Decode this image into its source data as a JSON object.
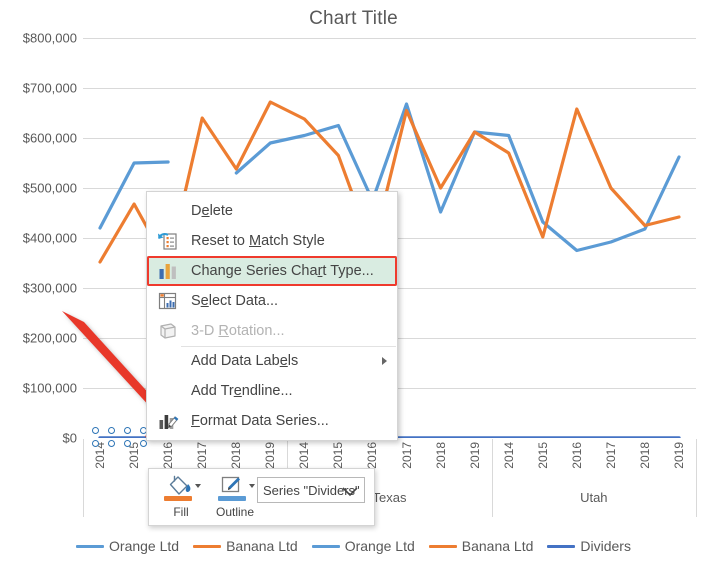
{
  "chart": {
    "title": "Chart Title",
    "y_ticks": [
      "$800,000",
      "$700,000",
      "$600,000",
      "$500,000",
      "$400,000",
      "$300,000",
      "$200,000",
      "$100,000",
      "$0"
    ],
    "years": [
      "2014",
      "2015",
      "2016",
      "2017",
      "2018",
      "2019"
    ],
    "groups": [
      "Texas",
      "Utah"
    ]
  },
  "chart_data": {
    "type": "line",
    "title": "Chart Title",
    "xlabel": "",
    "ylabel": "",
    "ylim": [
      0,
      800000
    ],
    "ytick_step": 100000,
    "grid": true,
    "legend_position": "bottom",
    "axis_note": "Two-level category axis: year (2014-2019) nested under state group; three state groups, the first group's name is hidden behind the mini-toolbar.",
    "categories": [
      "2014",
      "2015",
      "2016",
      "2017",
      "2018",
      "2019",
      "2014",
      "2015",
      "2016",
      "2017",
      "2018",
      "2019",
      "2014",
      "2015",
      "2016",
      "2017",
      "2018",
      "2019"
    ],
    "groups": [
      {
        "name": "",
        "years": [
          "2014",
          "2015",
          "2016",
          "2017",
          "2018",
          "2019"
        ]
      },
      {
        "name": "Texas",
        "years": [
          "2014",
          "2015",
          "2016",
          "2017",
          "2018",
          "2019"
        ]
      },
      {
        "name": "Utah",
        "years": [
          "2014",
          "2015",
          "2016",
          "2017",
          "2018",
          "2019"
        ]
      }
    ],
    "series": [
      {
        "name": "Orange Ltd",
        "color": "#5B9BD5",
        "values": [
          420000,
          550000,
          552000,
          null,
          530000,
          590000,
          605000,
          625000,
          475000,
          668000,
          452000,
          612000,
          605000,
          432000,
          375000,
          392000,
          418000,
          562000
        ]
      },
      {
        "name": "Banana Ltd",
        "color": "#ED7D31",
        "values": [
          352000,
          468000,
          345000,
          640000,
          538000,
          672000,
          638000,
          565000,
          378000,
          655000,
          500000,
          612000,
          570000,
          402000,
          658000,
          500000,
          425000,
          442000
        ]
      },
      {
        "name": "Dividers",
        "color": "#4472C4",
        "values": [
          0,
          0,
          0,
          0,
          0,
          0,
          0,
          0,
          0,
          0,
          0,
          0,
          0,
          0,
          0,
          0,
          0,
          0
        ],
        "note": "Flat helper series drawn along the $0 baseline; currently selected (round handles visible)."
      }
    ],
    "legend": [
      {
        "label": "Orange Ltd",
        "color": "#5B9BD5"
      },
      {
        "label": "Banana Ltd",
        "color": "#ED7D31"
      },
      {
        "label": "Orange Ltd",
        "color": "#5B9BD5"
      },
      {
        "label": "Banana Ltd",
        "color": "#ED7D31"
      },
      {
        "label": "Dividers",
        "color": "#4472C4"
      }
    ]
  },
  "context_menu": {
    "items": [
      {
        "label": "Delete",
        "icon": "none",
        "disabled": false,
        "highlighted": false,
        "submenu": false,
        "separator_above": false
      },
      {
        "label": "Reset to Match Style",
        "icon": "reset-style-icon",
        "disabled": false,
        "highlighted": false,
        "submenu": false,
        "separator_above": false
      },
      {
        "label": "Change Series Chart Type...",
        "icon": "chart-type-icon",
        "disabled": false,
        "highlighted": true,
        "submenu": false,
        "separator_above": true
      },
      {
        "label": "Select Data...",
        "icon": "select-data-icon",
        "disabled": false,
        "highlighted": false,
        "submenu": false,
        "separator_above": false
      },
      {
        "label": "3-D Rotation...",
        "icon": "rotation-icon",
        "disabled": true,
        "highlighted": false,
        "submenu": false,
        "separator_above": false
      },
      {
        "label": "Add Data Labels",
        "icon": "none",
        "disabled": false,
        "highlighted": false,
        "submenu": true,
        "separator_above": true
      },
      {
        "label": "Add Trendline...",
        "icon": "none",
        "disabled": false,
        "highlighted": false,
        "submenu": false,
        "separator_above": false
      },
      {
        "label": "Format Data Series...",
        "icon": "format-series-icon",
        "disabled": false,
        "highlighted": false,
        "submenu": false,
        "separator_above": false
      }
    ],
    "highlight_color": "#EF3A2D"
  },
  "mini_toolbar": {
    "fill_label": "Fill",
    "fill_color": "#ED7D31",
    "outline_label": "Outline",
    "outline_color": "#5B9BD5",
    "series_selector_value": "Series \"Dividers\""
  },
  "annotation": {
    "arrow_color": "#E8392B",
    "points_to": "dividers-series-baseline"
  }
}
